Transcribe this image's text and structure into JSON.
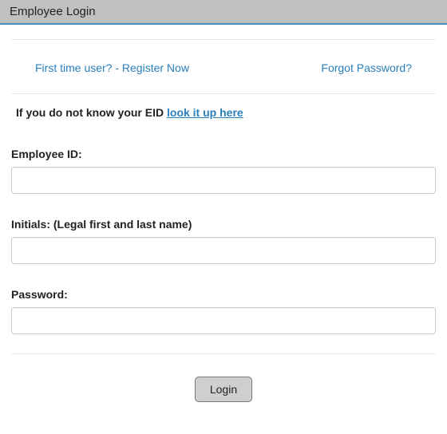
{
  "title": "Employee Login",
  "links": {
    "register": "First time user? - Register Now",
    "forgot": "Forgot Password?"
  },
  "hint": {
    "prefix": "If you do not know your EID ",
    "link": "look it up here"
  },
  "form": {
    "employee_id": {
      "label": "Employee ID:",
      "value": ""
    },
    "initials": {
      "label": "Initials: (Legal first and last name)",
      "value": ""
    },
    "password": {
      "label": "Password:",
      "value": ""
    }
  },
  "buttons": {
    "login": "Login"
  }
}
